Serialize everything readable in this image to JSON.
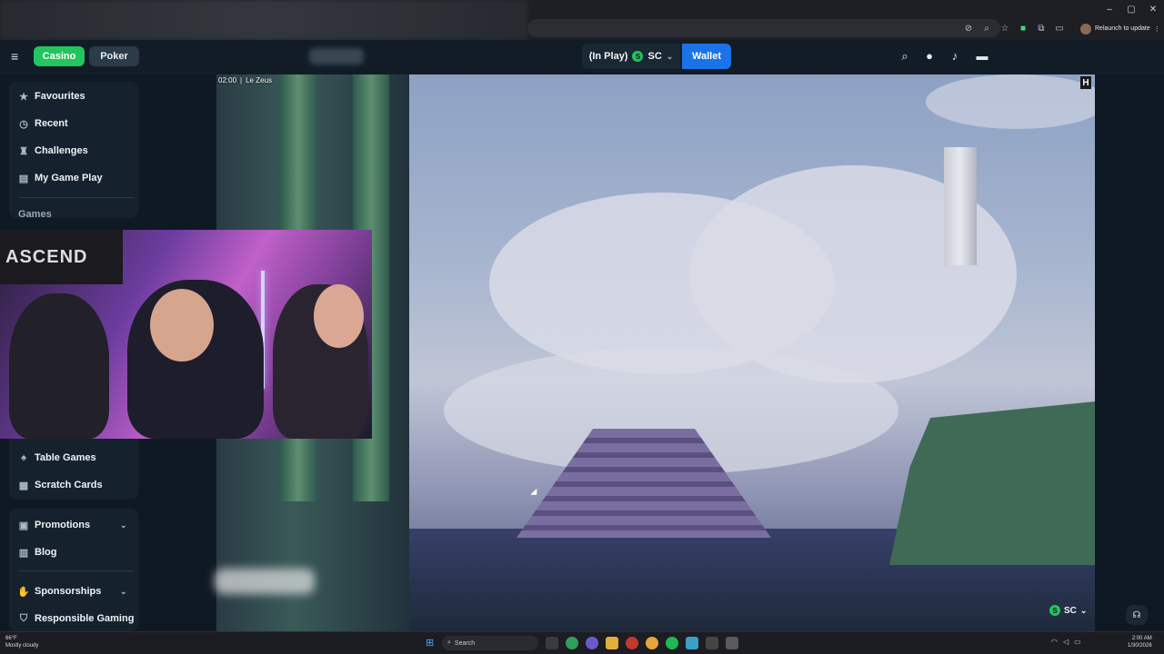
{
  "browser": {
    "relaunch_label": "Relaunch to update",
    "window_controls": [
      "–",
      "▢",
      "✕"
    ]
  },
  "header": {
    "casino_label": "Casino",
    "poker_label": "Poker",
    "balance_status": "(In Play)",
    "currency_coin": "S",
    "currency_code": "SC",
    "wallet_label": "Wallet",
    "icons": [
      "search-icon",
      "user-icon",
      "bell-icon",
      "chat-icon"
    ]
  },
  "sidebar": {
    "top_items": [
      {
        "label": "Favourites",
        "icon": "star-icon"
      },
      {
        "label": "Recent",
        "icon": "clock-icon"
      },
      {
        "label": "Challenges",
        "icon": "trophy-icon"
      },
      {
        "label": "My Game Play",
        "icon": "gameplay-icon"
      }
    ],
    "games_heading": "Games",
    "game_items": [
      {
        "label": "Table Games",
        "icon": "cards-icon"
      },
      {
        "label": "Scratch Cards",
        "icon": "grid-icon"
      }
    ],
    "bottom_items": [
      {
        "label": "Promotions",
        "icon": "gift-icon"
      },
      {
        "label": "Blog",
        "icon": "blog-icon"
      },
      {
        "label": "Sponsorships",
        "icon": "handshake-icon"
      },
      {
        "label": "Responsible Gaming",
        "icon": "shield-icon"
      }
    ]
  },
  "game": {
    "timestamp": "02:00",
    "title": "Le Zeus",
    "corner_logo": "H",
    "currency_coin": "S",
    "currency_code": "SC"
  },
  "webcam": {
    "banner_text": "ASCEND"
  },
  "taskbar": {
    "weather_temp": "66°F",
    "weather_desc": "Mostly cloudy",
    "search_placeholder": "Search",
    "time": "2:00 AM",
    "date": "1/30/2026"
  },
  "colors": {
    "casino_green": "#22c55e",
    "wallet_blue": "#1a73e8",
    "sidebar_bg": "#15222d",
    "page_bg": "#0f1923"
  }
}
